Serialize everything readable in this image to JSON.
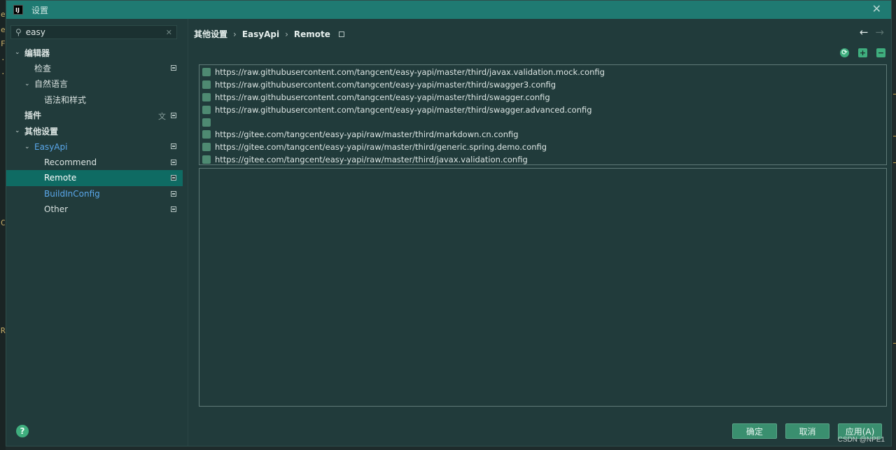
{
  "window": {
    "title": "设置",
    "logo_text": "IJ",
    "close_glyph": "✕"
  },
  "search": {
    "value": "easy",
    "placeholder": ""
  },
  "tree": [
    {
      "label": "编辑器",
      "level": 0,
      "expanded": true,
      "bold": true,
      "has_page_icon": false
    },
    {
      "label": "检查",
      "level": 1,
      "expanded": null,
      "bold": false,
      "has_page_icon": true
    },
    {
      "label": "自然语言",
      "level": 1,
      "expanded": true,
      "bold": false,
      "has_page_icon": false
    },
    {
      "label": "语法和样式",
      "level": 2,
      "expanded": null,
      "bold": false,
      "has_page_icon": false
    },
    {
      "label": "插件",
      "level": 0,
      "expanded": null,
      "bold": true,
      "has_page_icon": true,
      "has_translate_icon": true
    },
    {
      "label": "其他设置",
      "level": 0,
      "expanded": true,
      "bold": true,
      "has_page_icon": false
    },
    {
      "label": "EasyApi",
      "level": 1,
      "expanded": true,
      "bold": false,
      "link": true,
      "has_page_icon": true
    },
    {
      "label": "Recommend",
      "level": 2,
      "expanded": null,
      "bold": false,
      "has_page_icon": true
    },
    {
      "label": "Remote",
      "level": 2,
      "expanded": null,
      "bold": false,
      "selected": true,
      "has_page_icon": true
    },
    {
      "label": "BuildInConfig",
      "level": 2,
      "expanded": null,
      "bold": false,
      "link": true,
      "has_page_icon": true
    },
    {
      "label": "Other",
      "level": 2,
      "expanded": null,
      "bold": false,
      "has_page_icon": true
    }
  ],
  "breadcrumb": {
    "items": [
      "其他设置",
      "EasyApi",
      "Remote"
    ],
    "separator": "›"
  },
  "nav": {
    "back": "←",
    "forward": "→"
  },
  "toolbar": {
    "refresh": "⟳",
    "add": "+",
    "remove": "−"
  },
  "remote_list": [
    "https://raw.githubusercontent.com/tangcent/easy-yapi/master/third/javax.validation.mock.config",
    "https://raw.githubusercontent.com/tangcent/easy-yapi/master/third/swagger3.config",
    "https://raw.githubusercontent.com/tangcent/easy-yapi/master/third/swagger.config",
    "https://raw.githubusercontent.com/tangcent/easy-yapi/master/third/swagger.advanced.config",
    "",
    "https://gitee.com/tangcent/easy-yapi/raw/master/third/markdown.cn.config",
    "https://gitee.com/tangcent/easy-yapi/raw/master/third/generic.spring.demo.config",
    "https://gitee.com/tangcent/easy-yapi/raw/master/third/javax.validation.config"
  ],
  "buttons": {
    "help": "?",
    "ok": "确定",
    "cancel": "取消",
    "apply": "应用(A)"
  },
  "watermark": "CSDN @NPE1",
  "colors": {
    "accent": "#1f7a72",
    "selected": "#0f6b63",
    "link": "#5aa7ea",
    "button": "#3a8f6f"
  }
}
